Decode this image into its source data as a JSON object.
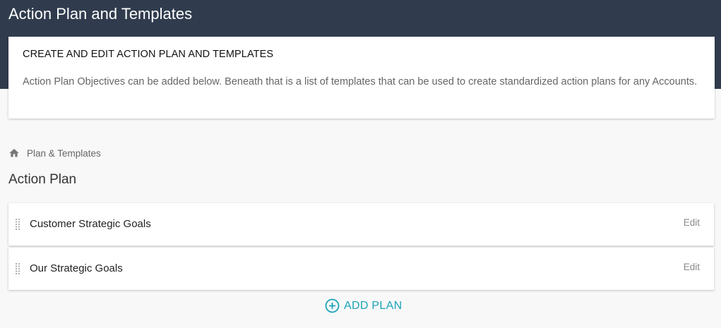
{
  "header": {
    "title": "Action Plan and Templates"
  },
  "intro": {
    "heading": "CREATE AND EDIT ACTION PLAN AND TEMPLATES",
    "body": "Action Plan Objectives can be added below. Beneath that is a list of templates that can be used to create standardized action plans for any Accounts."
  },
  "breadcrumb": {
    "icon": "home-icon",
    "label": "Plan & Templates"
  },
  "section": {
    "title": "Action Plan"
  },
  "plans": [
    {
      "label": "Customer Strategic Goals",
      "edit_label": "Edit"
    },
    {
      "label": "Our Strategic Goals",
      "edit_label": "Edit"
    }
  ],
  "add_plan": {
    "label": "ADD PLAN",
    "icon": "add-circle-icon"
  },
  "colors": {
    "header_bg": "#303c4e",
    "accent": "#1aa3b8",
    "page_bg": "#f8f8f8"
  }
}
